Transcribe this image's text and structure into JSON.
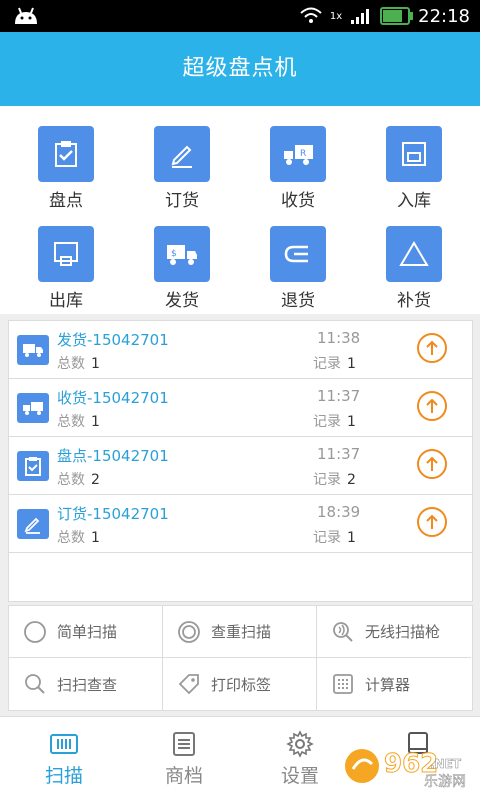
{
  "status": {
    "time": "22:18",
    "network": "1x",
    "battery_fill": 0.85
  },
  "header": {
    "title": "超级盘点机"
  },
  "grid": [
    {
      "label": "盘点",
      "icon": "clipboard-check-icon"
    },
    {
      "label": "订货",
      "icon": "pencil-note-icon"
    },
    {
      "label": "收货",
      "icon": "truck-receive-icon"
    },
    {
      "label": "入库",
      "icon": "inbox-icon"
    },
    {
      "label": "出库",
      "icon": "outbox-icon"
    },
    {
      "label": "发货",
      "icon": "truck-ship-icon"
    },
    {
      "label": "退货",
      "icon": "return-arrow-icon"
    },
    {
      "label": "补货",
      "icon": "triangle-icon"
    }
  ],
  "records": {
    "total_label": "总数",
    "count_label": "记录",
    "items": [
      {
        "title": "发货-15042701",
        "time": "11:38",
        "total": "1",
        "count": "1",
        "icon": "truck-ship-icon"
      },
      {
        "title": "收货-15042701",
        "time": "11:37",
        "total": "1",
        "count": "1",
        "icon": "truck-receive-icon"
      },
      {
        "title": "盘点-15042701",
        "time": "11:37",
        "total": "2",
        "count": "2",
        "icon": "clipboard-check-icon"
      },
      {
        "title": "订货-15042701",
        "time": "18:39",
        "total": "1",
        "count": "1",
        "icon": "pencil-note-icon"
      }
    ]
  },
  "tools": [
    {
      "label": "简单扫描",
      "icon": "circle-icon"
    },
    {
      "label": "查重扫描",
      "icon": "double-circle-icon"
    },
    {
      "label": "无线扫描枪",
      "icon": "wireless-scan-icon"
    },
    {
      "label": "扫扫查查",
      "icon": "search-icon"
    },
    {
      "label": "打印标签",
      "icon": "tag-icon"
    },
    {
      "label": "计算器",
      "icon": "calculator-icon"
    }
  ],
  "tabs": [
    {
      "label": "扫描",
      "icon": "barcode-icon",
      "active": true
    },
    {
      "label": "商档",
      "icon": "document-list-icon",
      "active": false
    },
    {
      "label": "设置",
      "icon": "gear-icon",
      "active": false
    },
    {
      "label": "",
      "icon": "tablet-icon",
      "active": false
    }
  ],
  "watermark": {
    "brand": "962",
    "suffix": ".NET",
    "sub": "乐游网"
  },
  "colors": {
    "header": "#2bb2e8",
    "icon_bg": "#4f8fe8",
    "link": "#2aa0d8",
    "upload": "#f08a1c"
  }
}
